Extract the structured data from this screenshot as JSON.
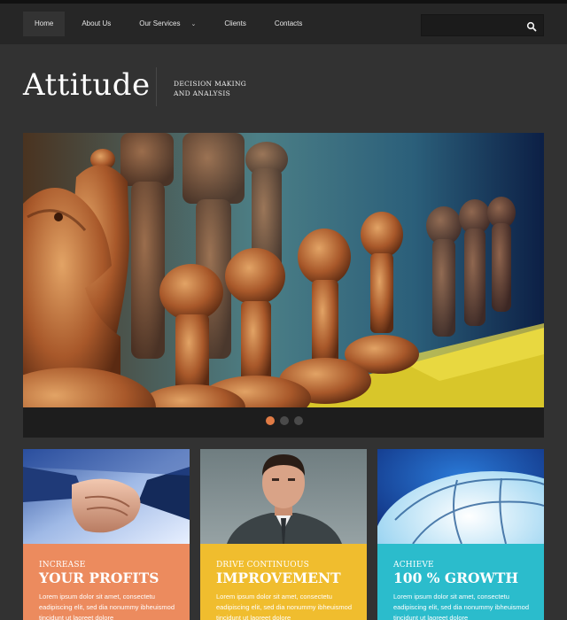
{
  "nav": {
    "items": [
      {
        "label": "Home",
        "active": true
      },
      {
        "label": "About Us"
      },
      {
        "label": "Our Services",
        "has_dropdown": true
      },
      {
        "label": "Clients"
      },
      {
        "label": "Contacts"
      }
    ]
  },
  "search": {
    "placeholder": "",
    "icon": "search-icon"
  },
  "brand": {
    "logo": "Attitude",
    "tagline_line1": "DECISION MAKING",
    "tagline_line2": "AND ANALYSIS"
  },
  "slider": {
    "image": "chess-pieces-photo",
    "slide_count": 3,
    "active_slide": 1
  },
  "features": [
    {
      "subtitle": "INCREASE",
      "title": "YOUR PROFITS",
      "text": "Lorem ipsum dolor sit amet, consectetu eadipiscing elit, sed dia nonummy ibheuismod tincidunt ut laoreet dolore",
      "image": "handshake-photo",
      "color": "#ec8b5e"
    },
    {
      "subtitle": "DRIVE CONTINUOUS",
      "title": "IMPROVEMENT",
      "text": "Lorem ipsum dolor sit amet, consectetu eadipiscing elit, sed dia nonummy ibheuismod tincidunt ut laoreet dolore",
      "image": "businessman-photo",
      "color": "#f0bd2e"
    },
    {
      "subtitle": "ACHIEVE",
      "title": "100 % GROWTH",
      "text": "Lorem ipsum dolor sit amet, consectetu eadipiscing elit, sed dia nonummy ibheuismod tincidunt ut laoreet dolore",
      "image": "puzzle-globe-photo",
      "color": "#2bbccc"
    }
  ],
  "colors": {
    "accent": "#e07b45",
    "navbar": "#262626",
    "background": "#323232"
  }
}
